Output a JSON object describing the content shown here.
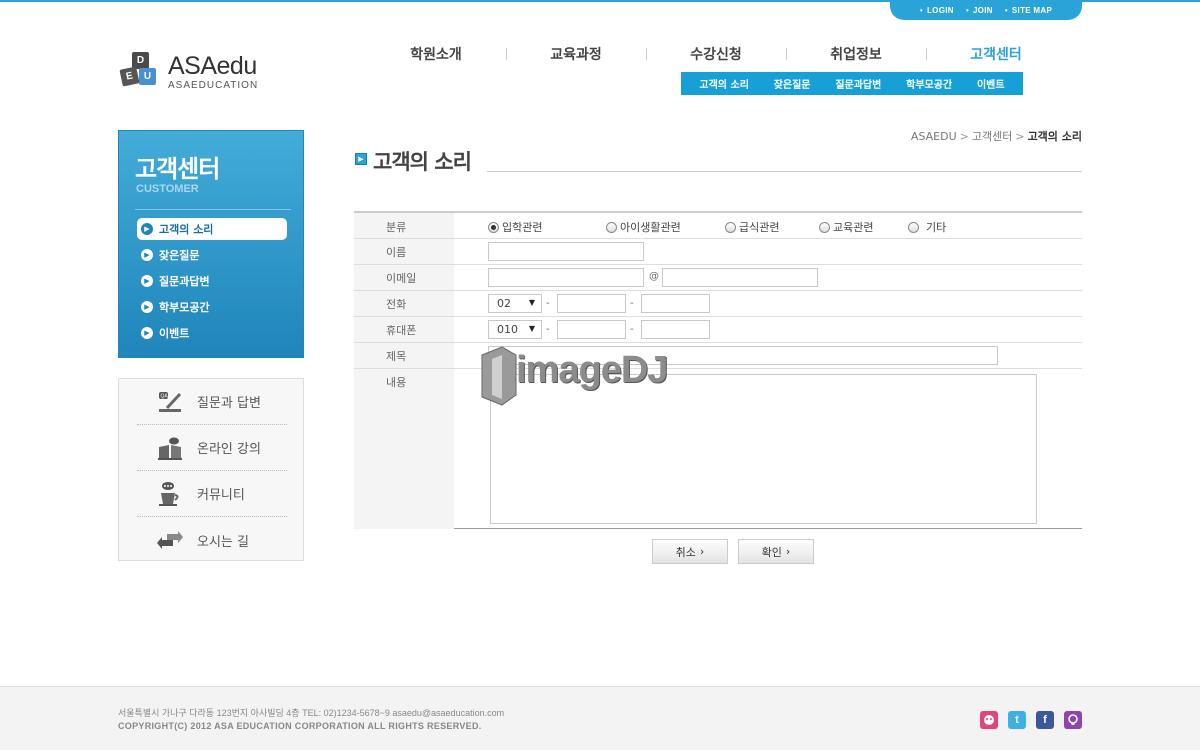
{
  "util_nav": [
    "LOGIN",
    "JOIN",
    "SITE MAP"
  ],
  "logo": {
    "letters": [
      "D",
      "E",
      "U"
    ],
    "name": "ASAedu",
    "sub": "ASAEDUCATION"
  },
  "gnb": [
    "학원소개",
    "교육과정",
    "수강신청",
    "취업정보",
    "고객센터"
  ],
  "sub_gnb": [
    "고객의 소리",
    "잦은질문",
    "질문과답변",
    "학부모공간",
    "이벤트"
  ],
  "lnb": {
    "title": "고객센터",
    "subtitle": "CUSTOMER",
    "items": [
      "고객의 소리",
      "잦은질문",
      "질문과답변",
      "학부모공간",
      "이벤트"
    ]
  },
  "quick": [
    "질문과 답변",
    "온라인 강의",
    "커뮤니티",
    "오시는 길"
  ],
  "breadcrumb": [
    "ASAEDU",
    "고객센터",
    "고객의 소리"
  ],
  "page_title": "고객의 소리",
  "form": {
    "labels": {
      "category": "분류",
      "name": "이름",
      "email": "이메일",
      "phone": "전화",
      "mobile": "휴대폰",
      "subject": "제목",
      "content": "내용"
    },
    "categories": [
      "입학관련",
      "아이생활관련",
      "급식관련",
      "교육관련",
      "기타"
    ],
    "email_at": "@",
    "dash": "-",
    "phone_prefix": "02",
    "mobile_prefix": "010"
  },
  "buttons": {
    "cancel": "취소",
    "confirm": "확인"
  },
  "watermark": "imageDJ",
  "footer": {
    "address": "서울특별시 가나구 다라동 123번지 아사빌딩 4층    TEL: 02)1234-5678~9    asaedu@asaeducation.com",
    "copyright": "COPYRIGHT(C) 2012 ASA EDUCATION CORPORATION ALL RIGHTS RESERVED."
  },
  "colors": {
    "accent": "#2aa3d8",
    "lnb_dark": "#1f85bb"
  }
}
